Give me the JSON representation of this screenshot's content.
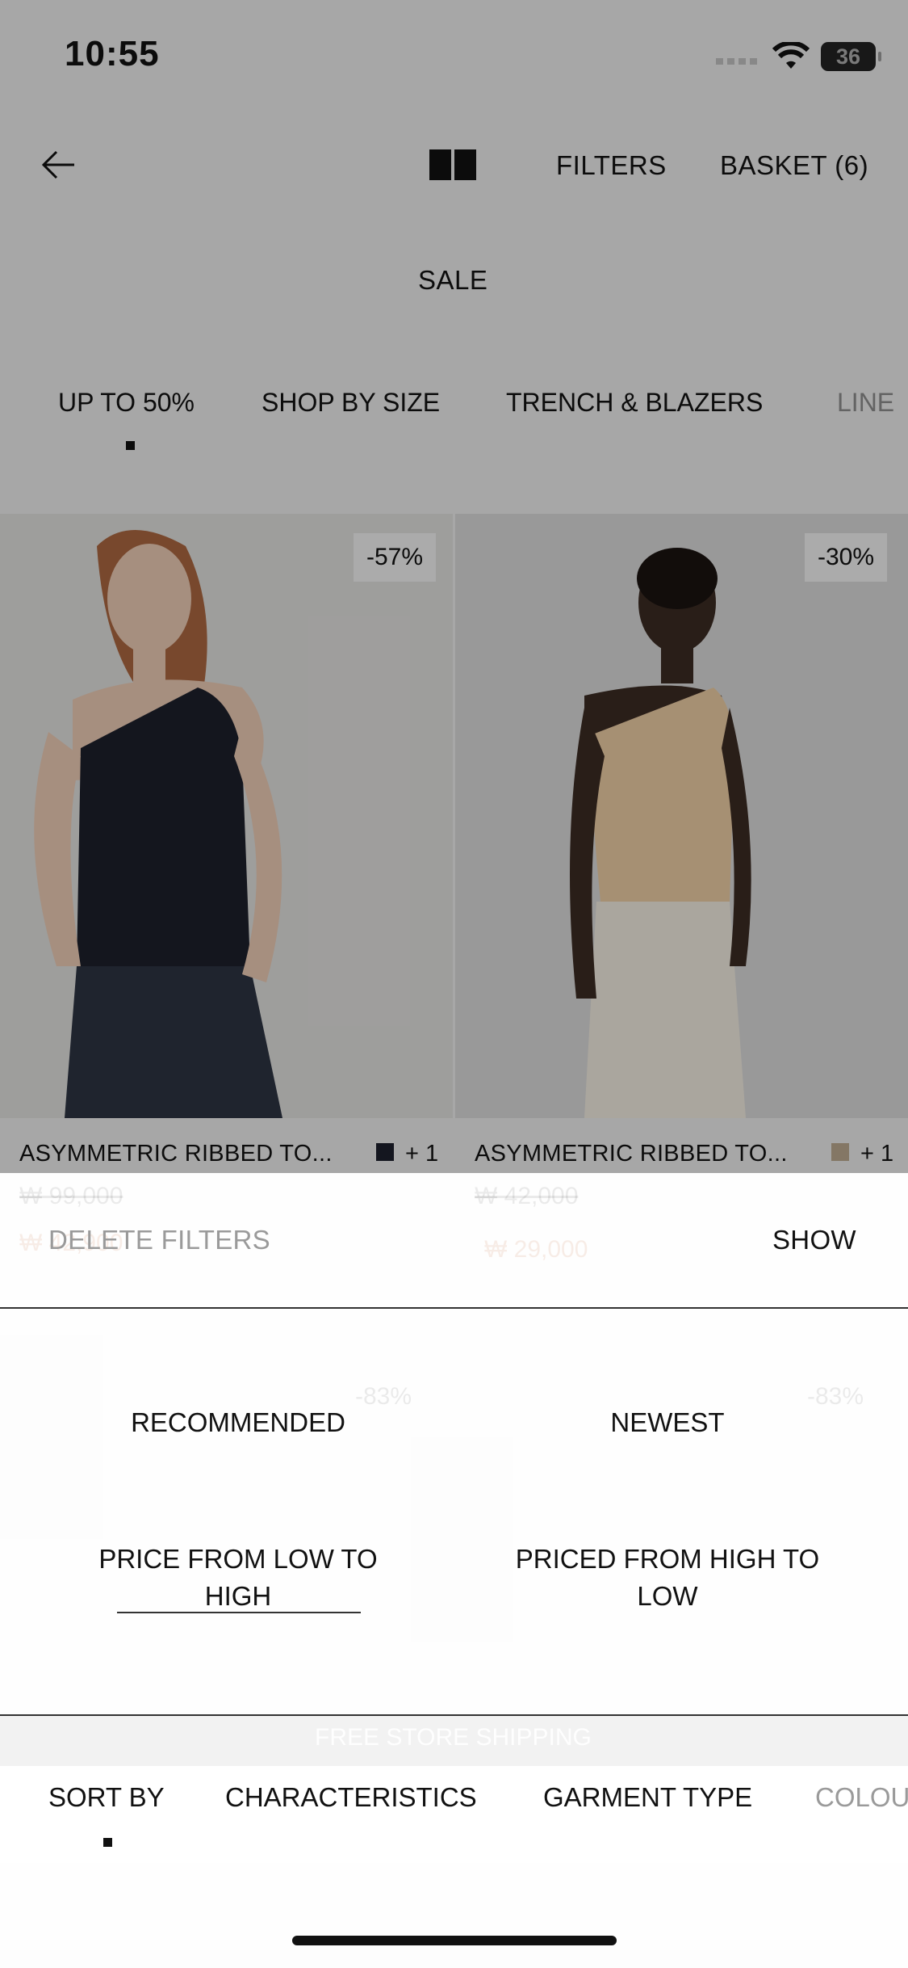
{
  "status": {
    "time": "10:55",
    "battery": "36"
  },
  "nav": {
    "filters_label": "FILTERS",
    "basket_label": "BASKET (6)"
  },
  "page_title": "SALE",
  "categories": [
    "UP TO 50%",
    "SHOP BY SIZE",
    "TRENCH & BLAZERS",
    "LINE"
  ],
  "products": [
    {
      "discount": "-57%",
      "name": "ASYMMETRIC RIBBED TO...",
      "swatch_color": "#1c1f2b",
      "more_colors": "+ 1",
      "old_price": "₩ 99,000",
      "new_price": "₩ 42,900"
    },
    {
      "discount": "-30%",
      "name": "ASYMMETRIC RIBBED TO...",
      "swatch_color": "#b7a58d",
      "more_colors": "+ 1",
      "old_price": "₩ 42,000",
      "new_price": "₩ 29,000"
    }
  ],
  "background_hidden": {
    "discount_3": "-83%",
    "discount_4": "-83%",
    "shipping": "FREE STORE SHIPPING"
  },
  "sheet": {
    "delete_filters": "DELETE FILTERS",
    "show": "SHOW",
    "sort_options": [
      "RECOMMENDED",
      "NEWEST",
      "PRICE FROM LOW TO HIGH",
      "PRICED FROM HIGH TO LOW"
    ],
    "tabs": [
      "SORT BY",
      "CHARACTERISTICS",
      "GARMENT TYPE",
      "COLOU"
    ]
  },
  "colors": {
    "accent": "#111111",
    "sheet_bg": "#ffffff"
  }
}
